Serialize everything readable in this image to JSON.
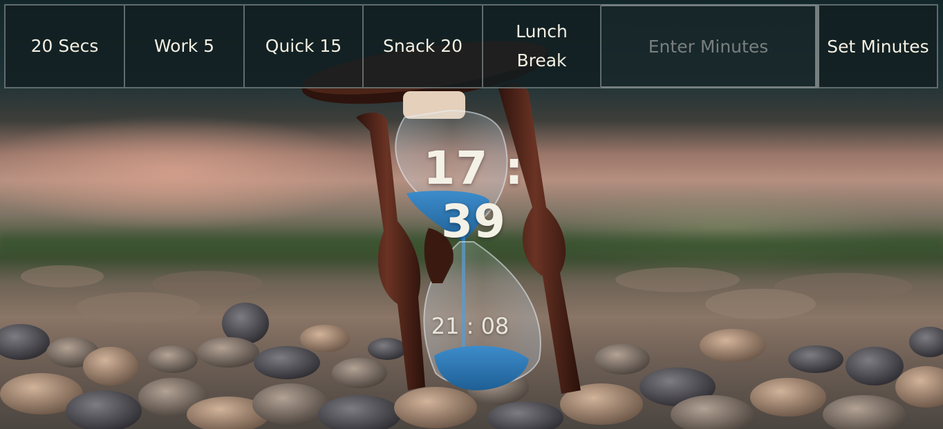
{
  "presets": [
    {
      "label": "20 Secs"
    },
    {
      "label": "Work 5"
    },
    {
      "label": "Quick 15"
    },
    {
      "label": "Snack 20"
    },
    {
      "label": "Lunch Break"
    }
  ],
  "minutes_input": {
    "value": "",
    "placeholder": "Enter Minutes"
  },
  "set_button": {
    "label": "Set Minutes"
  },
  "timer": {
    "countdown": "17 : 39",
    "end_time": "21 : 08"
  },
  "background": {
    "scene": "hourglass-on-pebbles",
    "colors": {
      "sand": "#2f7fbf",
      "wood": "#4a2218",
      "sky": "#14282c"
    }
  }
}
